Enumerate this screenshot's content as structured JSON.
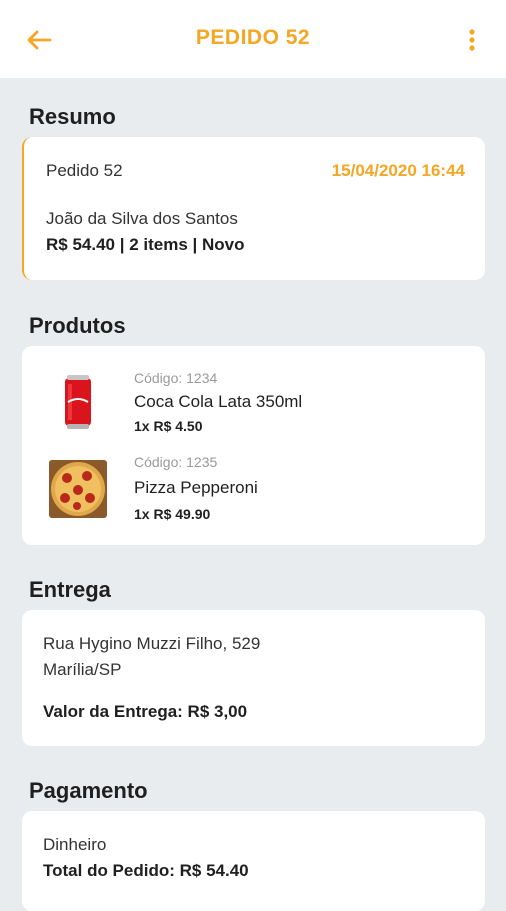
{
  "colors": {
    "accent": "#f5a623",
    "background": "#e9ecee",
    "card": "#ffffff"
  },
  "appbar": {
    "title": "PEDIDO 52",
    "back_icon": "arrow-left-icon",
    "menu_icon": "more-vertical-icon"
  },
  "resumo": {
    "section_title": "Resumo",
    "order_label": "Pedido 52",
    "datetime": "15/04/2020 16:44",
    "customer": "João da Silva dos Santos",
    "summary": "R$ 54.40 | 2 items | Novo"
  },
  "produtos": {
    "section_title": "Produtos",
    "items": [
      {
        "code": "Código: 1234",
        "name": "Coca Cola Lata 350ml",
        "qty_price": "1x R$ 4.50",
        "image": "soda-can-image"
      },
      {
        "code": "Código: 1235",
        "name": "Pizza Pepperoni",
        "qty_price": "1x R$ 49.90",
        "image": "pizza-image"
      }
    ]
  },
  "entrega": {
    "section_title": "Entrega",
    "address_line1": "Rua Hygino Muzzi Filho, 529",
    "address_line2": "Marília/SP",
    "fee": "Valor da Entrega: R$ 3,00"
  },
  "pagamento": {
    "section_title": "Pagamento",
    "method": "Dinheiro",
    "total": "Total do Pedido: R$ 54.40"
  }
}
